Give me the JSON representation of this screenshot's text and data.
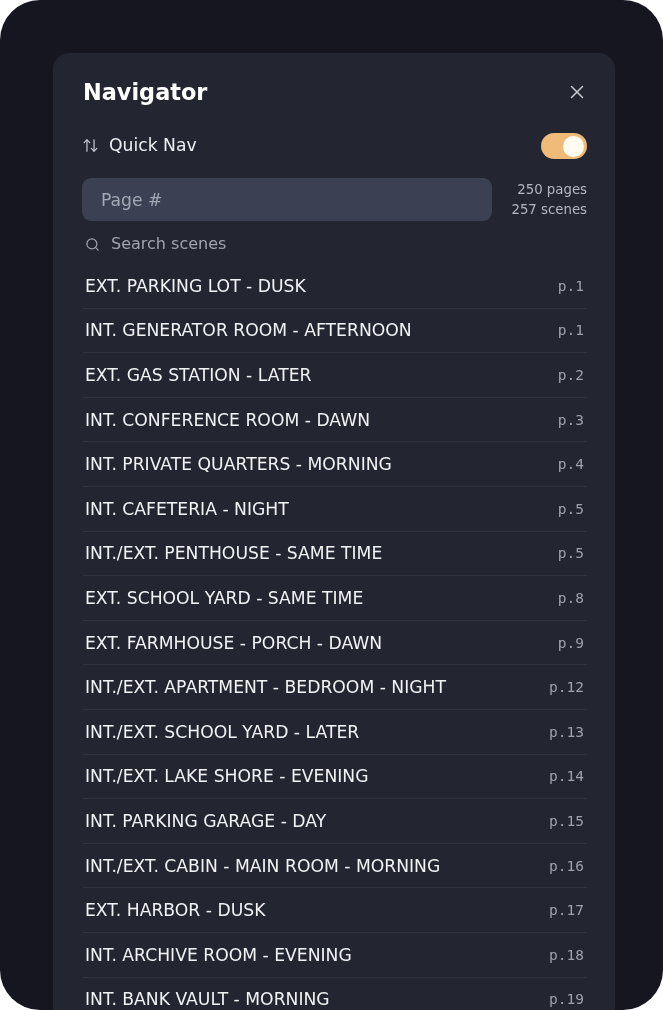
{
  "dialog": {
    "title": "Navigator"
  },
  "quick_nav": {
    "label": "Quick Nav",
    "on": true
  },
  "page_field": {
    "placeholder": "Page #"
  },
  "stats": [
    "250 pages",
    "257 scenes"
  ],
  "search": {
    "placeholder": "Search scenes"
  },
  "scenes": [
    {
      "heading": "EXT. PARKING LOT - DUSK",
      "page": "p.1"
    },
    {
      "heading": "INT. GENERATOR ROOM - AFTERNOON",
      "page": "p.1"
    },
    {
      "heading": "EXT. GAS STATION - LATER",
      "page": "p.2"
    },
    {
      "heading": "INT. CONFERENCE ROOM - DAWN",
      "page": "p.3"
    },
    {
      "heading": "INT. PRIVATE QUARTERS - MORNING",
      "page": "p.4"
    },
    {
      "heading": "INT. CAFETERIA - NIGHT",
      "page": "p.5"
    },
    {
      "heading": "INT./EXT. PENTHOUSE - SAME TIME",
      "page": "p.5"
    },
    {
      "heading": "EXT. SCHOOL YARD - SAME TIME",
      "page": "p.8"
    },
    {
      "heading": "EXT. FARMHOUSE - PORCH - DAWN",
      "page": "p.9"
    },
    {
      "heading": "INT./EXT. APARTMENT - BEDROOM - NIGHT",
      "page": "p.12"
    },
    {
      "heading": "INT./EXT. SCHOOL YARD - LATER",
      "page": "p.13"
    },
    {
      "heading": "INT./EXT. LAKE SHORE - EVENING",
      "page": "p.14"
    },
    {
      "heading": "INT. PARKING GARAGE - DAY",
      "page": "p.15"
    },
    {
      "heading": "INT./EXT. CABIN - MAIN ROOM - MORNING",
      "page": "p.16"
    },
    {
      "heading": "EXT. HARBOR - DUSK",
      "page": "p.17"
    },
    {
      "heading": "INT. ARCHIVE ROOM - EVENING",
      "page": "p.18"
    },
    {
      "heading": "INT. BANK VAULT - MORNING",
      "page": "p.19"
    }
  ]
}
